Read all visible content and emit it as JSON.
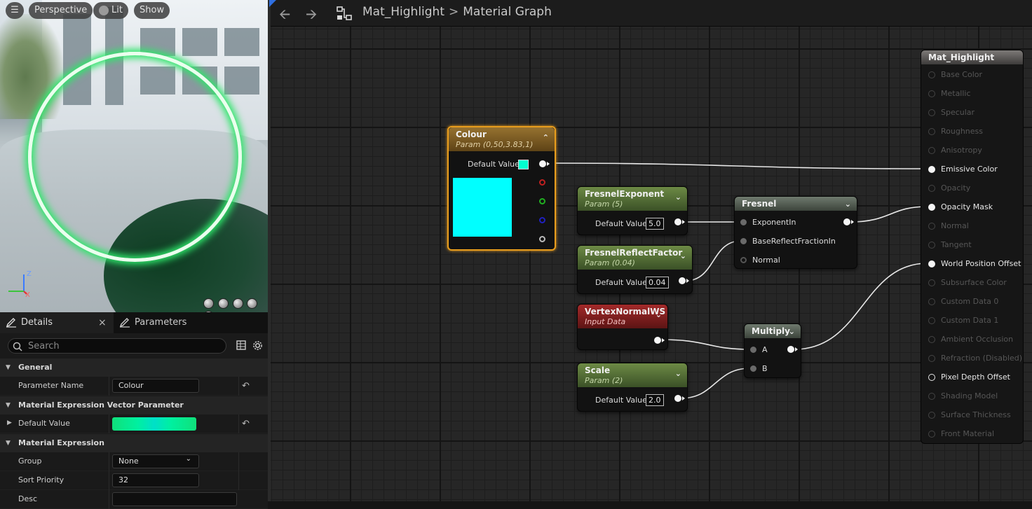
{
  "viewport": {
    "menu_icon": "hamburger-icon",
    "perspective_label": "Perspective",
    "lit_label": "Lit",
    "show_label": "Show",
    "axis_z": "Z",
    "axis_x": "X"
  },
  "details": {
    "tab_details": "Details",
    "tab_close": "×",
    "tab_parameters": "Parameters",
    "search_placeholder": "Search",
    "sections": {
      "general": "General",
      "vector_param": "Material Expression Vector Parameter",
      "expression": "Material Expression"
    },
    "rows": {
      "parameter_name": {
        "label": "Parameter Name",
        "value": "Colour"
      },
      "default_value": {
        "label": "Default Value"
      },
      "group": {
        "label": "Group",
        "value": "None"
      },
      "sort_priority": {
        "label": "Sort Priority",
        "value": "32"
      },
      "desc": {
        "label": "Desc"
      }
    },
    "default_value_color": "#00f0a0"
  },
  "toolbar": {
    "back_icon": "arrow-left-icon",
    "forward_icon": "arrow-right-icon",
    "breadcrumb_root": "Mat_Highlight",
    "breadcrumb_sep": ">",
    "breadcrumb_current": "Material Graph"
  },
  "nodes": {
    "colour": {
      "title": "Colour",
      "subtitle": "Param (0,50,3.83,1)",
      "default_label": "Default Value",
      "swatch": "#00ffff"
    },
    "fresnel_exponent": {
      "title": "FresnelExponent",
      "subtitle": "Param (5)",
      "default_label": "Default Value",
      "value": "5.0"
    },
    "fresnel_reflect": {
      "title": "FresnelReflectFactor",
      "subtitle": "Param (0.04)",
      "default_label": "Default Value",
      "value": "0.04"
    },
    "vertex_normal": {
      "title": "VertexNormalWS",
      "subtitle": "Input Data"
    },
    "scale": {
      "title": "Scale",
      "subtitle": "Param (2)",
      "default_label": "Default Value",
      "value": "2.0"
    },
    "fresnel": {
      "title": "Fresnel",
      "pins": [
        "ExponentIn",
        "BaseReflectFractionIn",
        "Normal"
      ]
    },
    "multiply": {
      "title": "Multiply",
      "pins": [
        "A",
        "B"
      ]
    },
    "result": {
      "title": "Mat_Highlight",
      "pins": [
        "Base Color",
        "Metallic",
        "Specular",
        "Roughness",
        "Anisotropy",
        "Emissive Color",
        "Opacity",
        "Opacity Mask",
        "Normal",
        "Tangent",
        "World Position Offset",
        "Subsurface Color",
        "Custom Data 0",
        "Custom Data 1",
        "Ambient Occlusion",
        "Refraction (Disabled)",
        "Pixel Depth Offset",
        "Shading Model",
        "Surface Thickness",
        "Front Material"
      ]
    }
  }
}
